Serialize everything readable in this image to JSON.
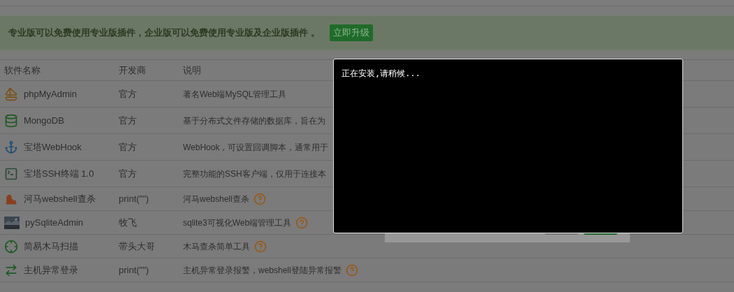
{
  "banner": {
    "text": "专业版可以免费使用专业版插件，企业版可以免费使用专业版及企业版插件 。",
    "button": "立即升级"
  },
  "table": {
    "columns": [
      "软件名称",
      "开发商",
      "说明"
    ],
    "rows": [
      {
        "kind": "sailboat",
        "name": "phpMyAdmin",
        "developer": "官方",
        "description": "著名Web端MySQL管理工具",
        "help": false
      },
      {
        "kind": "database",
        "name": "MongoDB",
        "developer": "官方",
        "description": "基于分布式文件存储的数据库，旨在为",
        "help": false
      },
      {
        "kind": "anchor",
        "name": "宝塔WebHook",
        "developer": "官方",
        "description": "WebHook，可设置回调脚本，通常用于",
        "help": false
      },
      {
        "kind": "terminal",
        "name": "宝塔SSH终端 1.0",
        "developer": "官方",
        "description": "完整功能的SSH客户端，仅用于连接本",
        "help": false
      },
      {
        "kind": "hippo",
        "name": "河马webshell查杀",
        "developer": "print(\"\")",
        "description": "河马webshell查杀",
        "help": true
      },
      {
        "kind": "picture",
        "name": "pySqliteAdmin",
        "developer": "牧飞",
        "description": "sqlite3可视化Web端管理工具",
        "help": true
      },
      {
        "kind": "crosshair",
        "name": "简易木马扫描",
        "developer": "带头大哥",
        "description": "木马查杀简单工具",
        "help": true
      },
      {
        "kind": "arrows",
        "name": "主机异常登录",
        "developer": "print(\"\")",
        "description": "主机异常登录报警，webshell登陆异常报警",
        "help": true
      }
    ]
  },
  "terminal": {
    "text": "正在安装,请稍候..."
  }
}
